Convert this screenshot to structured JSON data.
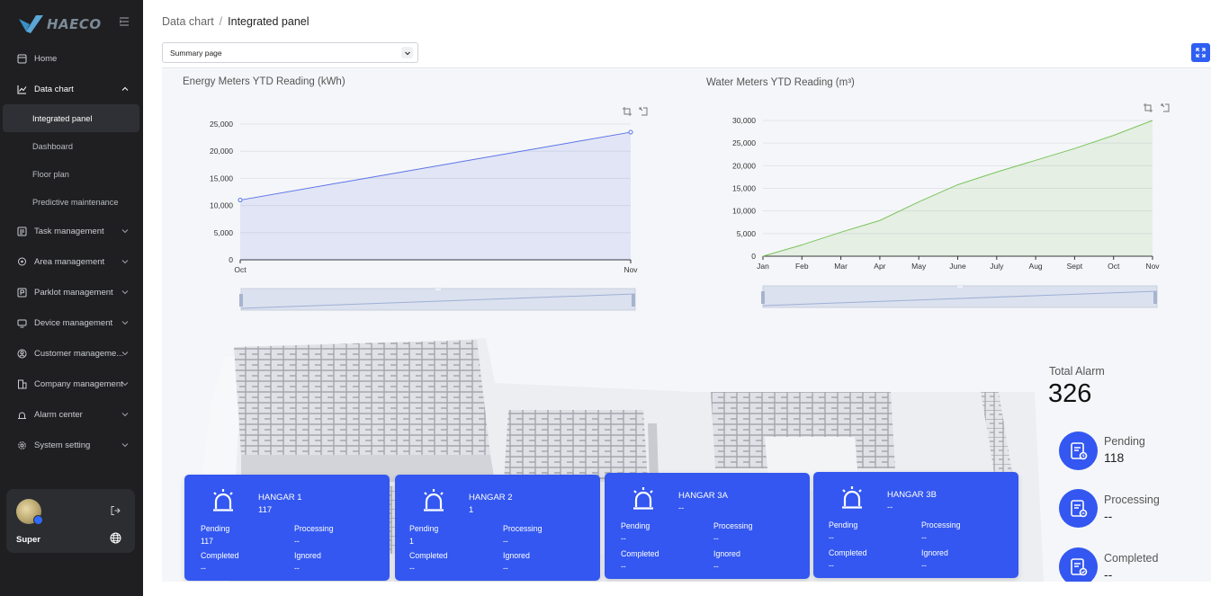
{
  "app": {
    "logo_text": "HAECO",
    "brand_color": "#2f5ef3",
    "sidebar_bg": "#1f1f21"
  },
  "sidebar": {
    "items": [
      {
        "label": "Home",
        "icon": "home-icon"
      },
      {
        "label": "Data chart",
        "icon": "line-chart-icon",
        "expanded": true,
        "children": [
          "Integrated panel",
          "Dashboard",
          "Floor plan",
          "Predictive maintenance"
        ]
      },
      {
        "label": "Task management",
        "icon": "task-icon"
      },
      {
        "label": "Area management",
        "icon": "location-pin-icon"
      },
      {
        "label": "Parklot management",
        "icon": "parking-icon"
      },
      {
        "label": "Device management",
        "icon": "device-icon"
      },
      {
        "label": "Customer manageme...",
        "icon": "customer-icon"
      },
      {
        "label": "Company management",
        "icon": "building-icon"
      },
      {
        "label": "Alarm center",
        "icon": "alarm-icon"
      },
      {
        "label": "System setting",
        "icon": "gear-icon"
      }
    ],
    "active_child": "Integrated panel",
    "user": {
      "name": "Super"
    }
  },
  "header": {
    "breadcrumb": [
      "Data chart",
      "Integrated panel"
    ],
    "page_select": {
      "value": "Summary page"
    }
  },
  "chart_data": [
    {
      "type": "area",
      "title": "Energy Meters YTD Reading (kWh)",
      "x": [
        "Oct",
        "Nov"
      ],
      "y_ticks": [
        0,
        5000,
        10000,
        15000,
        20000,
        25000
      ],
      "y_tick_labels": [
        "0",
        "5,000",
        "10,000",
        "15,000",
        "20,000",
        "25,000"
      ],
      "ylim": [
        0,
        25000
      ],
      "series": [
        {
          "values": [
            11000,
            23500
          ],
          "color": "#5b73e8"
        }
      ],
      "grid": true
    },
    {
      "type": "area",
      "title": "Water Meters YTD Reading (m³)",
      "x": [
        "Jan",
        "Feb",
        "Mar",
        "Apr",
        "May",
        "June",
        "July",
        "Aug",
        "Sept",
        "Oct",
        "Nov"
      ],
      "y_ticks": [
        0,
        5000,
        10000,
        15000,
        20000,
        25000,
        30000
      ],
      "y_tick_labels": [
        "0",
        "5,000",
        "10,000",
        "15,000",
        "20,000",
        "25,000",
        "30,000"
      ],
      "ylim": [
        0,
        30000
      ],
      "series": [
        {
          "values": [
            0,
            2500,
            5300,
            7900,
            12000,
            15800,
            18600,
            21200,
            23800,
            26700,
            30000
          ],
          "color": "#7bc55b"
        }
      ],
      "grid": true
    }
  ],
  "hangars": [
    {
      "name": "HANGAR 1",
      "total": "117",
      "pending_label": "Pending",
      "pending": "117",
      "processing_label": "Processing",
      "processing": "--",
      "completed_label": "Completed",
      "completed": "--",
      "ignored_label": "Ignored",
      "ignored": "--"
    },
    {
      "name": "HANGAR 2",
      "total": "1",
      "pending_label": "Pending",
      "pending": "1",
      "processing_label": "Processing",
      "processing": "--",
      "completed_label": "Completed",
      "completed": "--",
      "ignored_label": "Ignored",
      "ignored": "--"
    },
    {
      "name": "HANGAR 3A",
      "total": "--",
      "pending_label": "Pending",
      "pending": "--",
      "processing_label": "Processing",
      "processing": "--",
      "completed_label": "Completed",
      "completed": "--",
      "ignored_label": "Ignored",
      "ignored": "--"
    },
    {
      "name": "HANGAR 3B",
      "total": "--",
      "pending_label": "Pending",
      "pending": "--",
      "processing_label": "Processing",
      "processing": "--",
      "completed_label": "Completed",
      "completed": "--",
      "ignored_label": "Ignored",
      "ignored": "--"
    }
  ],
  "alarm": {
    "title": "Total Alarm",
    "total": "326",
    "statuses": [
      {
        "label": "Pending",
        "value": "118"
      },
      {
        "label": "Processing",
        "value": "--"
      },
      {
        "label": "Completed",
        "value": "--"
      }
    ]
  }
}
